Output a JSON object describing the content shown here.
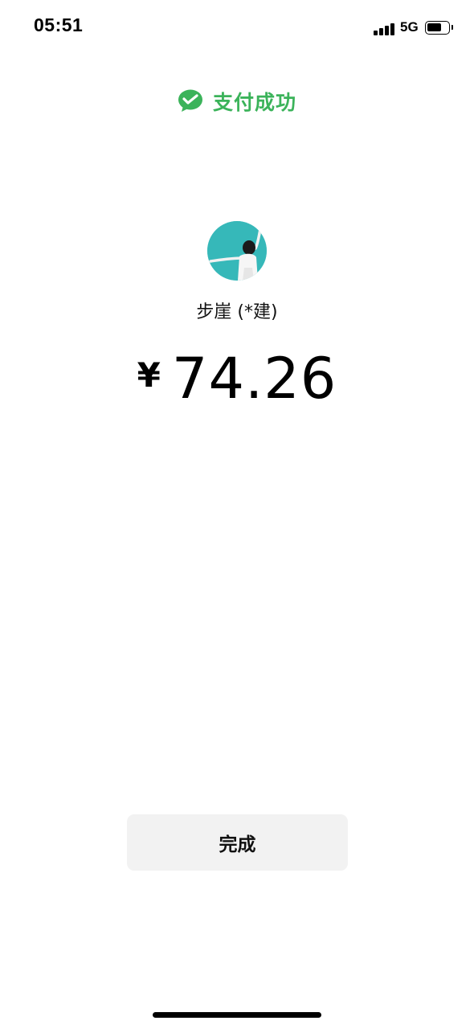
{
  "status_bar": {
    "time": "05:51",
    "network": "5G",
    "signal_icon": "cellular-signal-icon",
    "battery_icon": "battery-icon",
    "battery_level": 0.7
  },
  "header": {
    "icon": "wechat-pay-icon",
    "title": "支付成功"
  },
  "payee": {
    "avatar": "payee-avatar",
    "name": "步崖 (*建)"
  },
  "payment": {
    "currency_symbol": "¥",
    "amount": "74.26"
  },
  "actions": {
    "done_label": "完成"
  },
  "colors": {
    "accent": "#3BB35A",
    "button_bg": "#F2F2F2",
    "avatar_bg": "#2FB2B4",
    "text": "#000000"
  }
}
